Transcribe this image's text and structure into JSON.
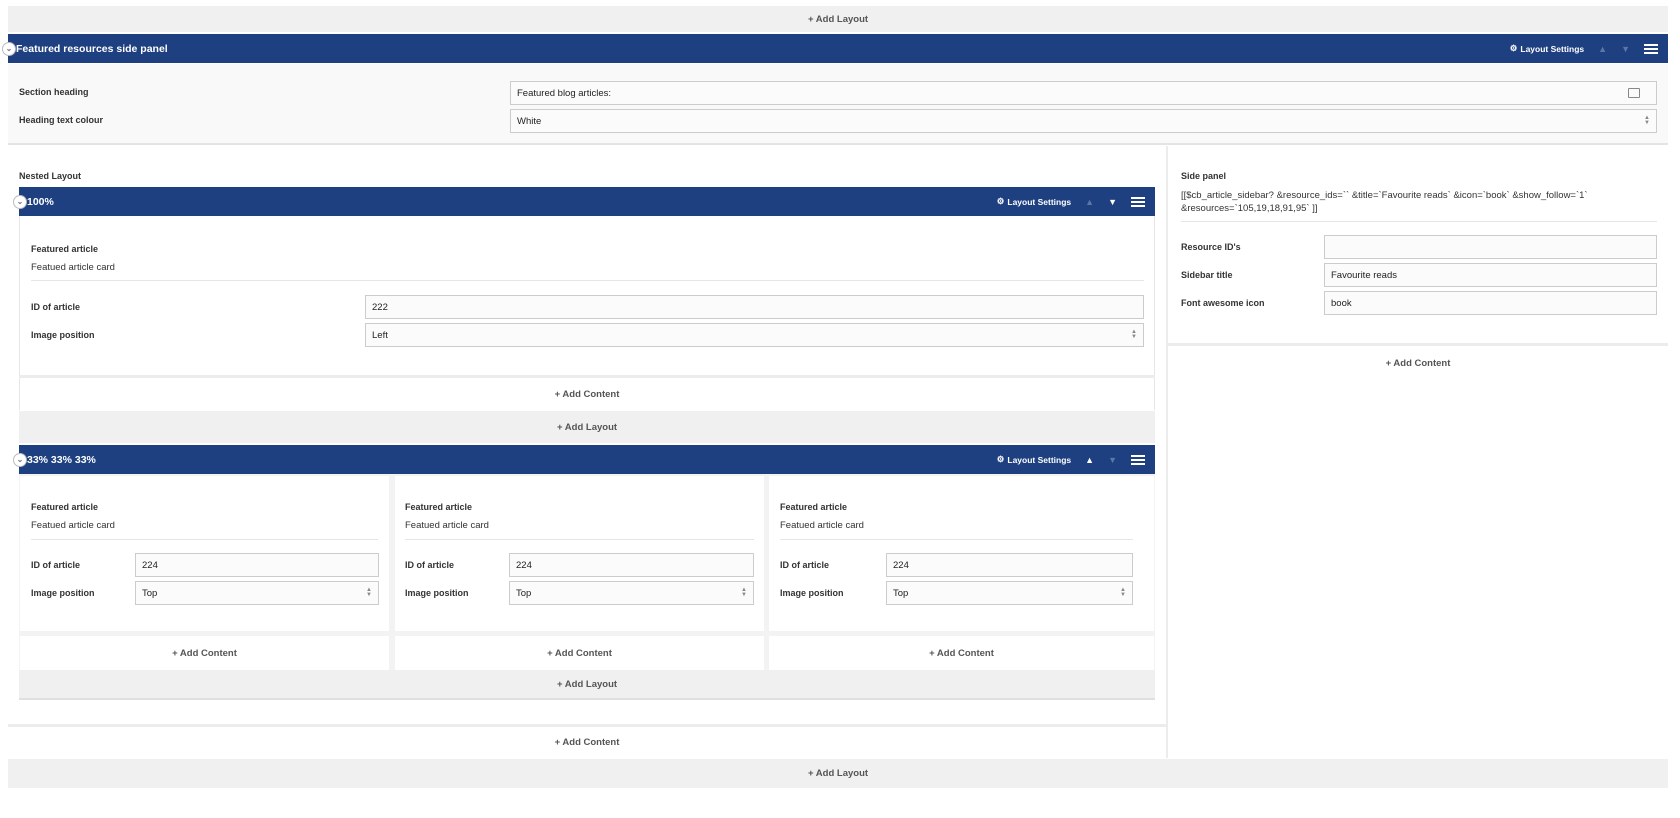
{
  "top_add_layout": "+ Add Layout",
  "bottom_add_layout": "+ Add Layout",
  "outer": {
    "title": "Featured resources side panel",
    "settings": "Layout Settings",
    "section_heading_label": "Section heading",
    "section_heading_value": "Featured blog articles:",
    "heading_colour_label": "Heading text colour",
    "heading_colour_value": "White"
  },
  "nested": {
    "label": "Nested Layout",
    "row1": {
      "title": "100%",
      "settings": "Layout Settings",
      "card_title": "Featured article",
      "card_sub": "Featued article card",
      "id_label": "ID of article",
      "id_value": "222",
      "pos_label": "Image position",
      "pos_value": "Left",
      "add_content": "+ Add Content",
      "add_layout": "+ Add Layout"
    },
    "row2": {
      "title": "33% 33% 33%",
      "settings": "Layout Settings",
      "cols": [
        {
          "card_title": "Featured article",
          "card_sub": "Featued article card",
          "id_label": "ID of article",
          "id_value": "224",
          "pos_label": "Image position",
          "pos_value": "Top",
          "add_content": "+ Add Content"
        },
        {
          "card_title": "Featured article",
          "card_sub": "Featued article card",
          "id_label": "ID of article",
          "id_value": "224",
          "pos_label": "Image position",
          "pos_value": "Top",
          "add_content": "+ Add Content"
        },
        {
          "card_title": "Featured article",
          "card_sub": "Featued article card",
          "id_label": "ID of article",
          "id_value": "224",
          "pos_label": "Image position",
          "pos_value": "Top",
          "add_content": "+ Add Content"
        }
      ],
      "add_layout": "+ Add Layout"
    },
    "add_content": "+ Add Content"
  },
  "side": {
    "label": "Side panel",
    "code_line1": "[[$cb_article_sidebar? &resource_ids=`` &title=`Favourite reads` &icon=`book` &show_follow=`1`",
    "code_line2": "&resources=`105,19,18,91,95` ]]",
    "resource_ids_label": "Resource ID's",
    "resource_ids_value": "",
    "sidebar_title_label": "Sidebar title",
    "sidebar_title_value": "Favourite reads",
    "icon_label": "Font awesome icon",
    "icon_value": "book",
    "add_content": "+ Add Content"
  }
}
